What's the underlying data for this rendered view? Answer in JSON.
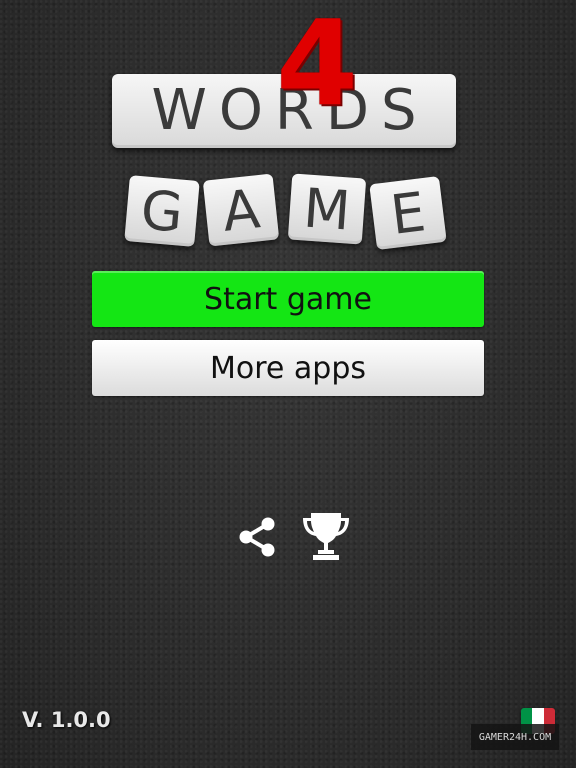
{
  "logo": {
    "number": "4",
    "word_top": "WORDS",
    "tiles": [
      "G",
      "A",
      "M",
      "E"
    ],
    "number_color": "#e00000"
  },
  "menu": {
    "start_label": "Start game",
    "more_label": "More apps",
    "start_color": "#14e614"
  },
  "icons": {
    "share": "share-icon",
    "trophy": "trophy-icon"
  },
  "footer": {
    "version": "V. 1.0.0",
    "language_flag": "italy-flag-icon",
    "flag_colors": [
      "#009246",
      "#ffffff",
      "#ce2b37"
    ],
    "watermark": "GAMER24H.COM"
  }
}
